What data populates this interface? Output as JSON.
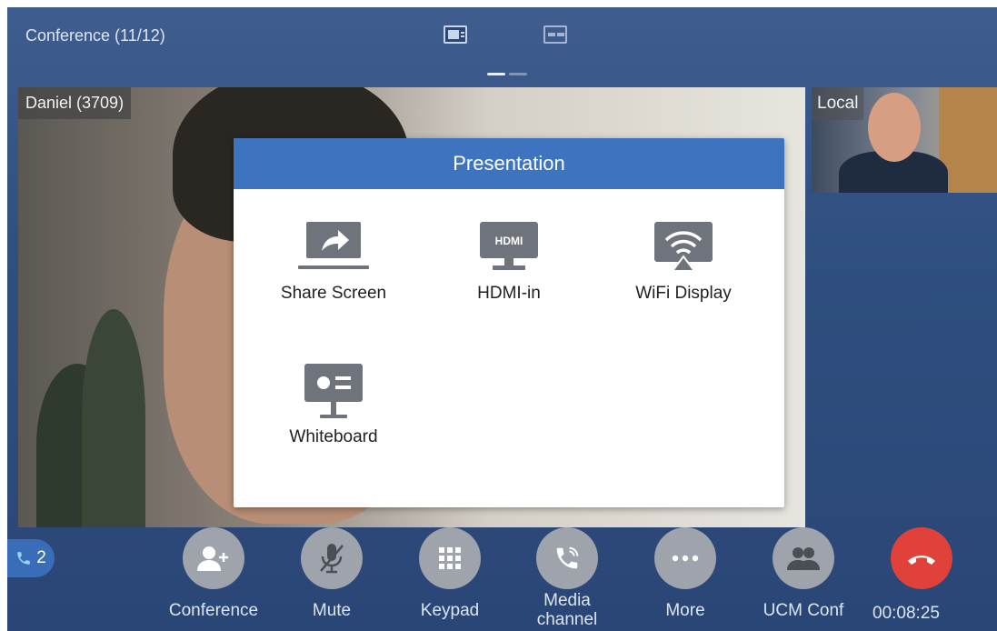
{
  "top_bar": {
    "conference_label": "Conference (11/12)"
  },
  "main_video": {
    "participant_name": "Daniel (3709)"
  },
  "self_view": {
    "label": "Local"
  },
  "dialog": {
    "title": "Presentation",
    "options": [
      {
        "label": "Share Screen",
        "icon": "share-screen-icon"
      },
      {
        "label": "HDMI-in",
        "icon": "hdmi-icon",
        "icon_text": "HDMI"
      },
      {
        "label": "WiFi Display",
        "icon": "wifi-display-icon"
      },
      {
        "label": "Whiteboard",
        "icon": "whiteboard-icon"
      }
    ]
  },
  "call_badge": {
    "count": "2",
    "icon": "phone-icon"
  },
  "controls": [
    {
      "label": "Conference",
      "icon": "add-person-icon"
    },
    {
      "label": "Mute",
      "icon": "mic-off-icon"
    },
    {
      "label": "Keypad",
      "icon": "keypad-icon"
    },
    {
      "label": "Media channel",
      "icon": "media-channel-icon"
    },
    {
      "label": "More",
      "icon": "more-icon"
    },
    {
      "label": "UCM Conf",
      "icon": "group-icon"
    },
    {
      "label": "00:08:25",
      "icon": "hang-up-icon"
    }
  ],
  "colors": {
    "accent": "#3e74bf",
    "end_call": "#e0413a",
    "background": "#2f4f80"
  }
}
